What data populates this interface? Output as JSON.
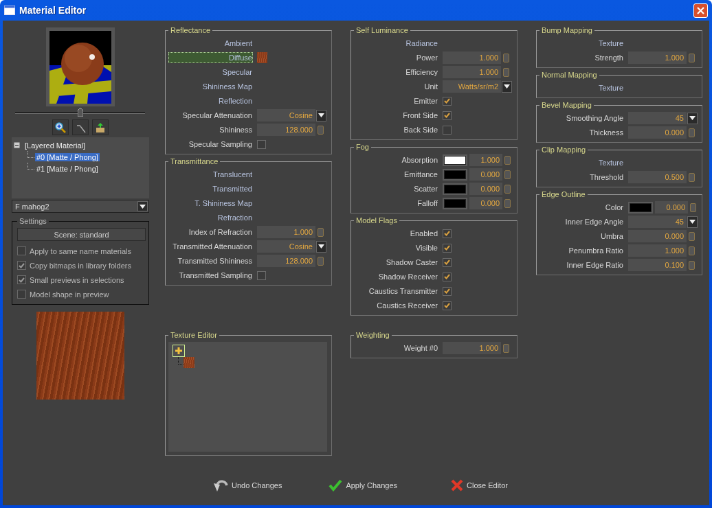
{
  "window": {
    "title": "Material Editor"
  },
  "preview": {
    "zoom_slider": {
      "level": 0.5
    }
  },
  "tree": [
    {
      "label": "[Layered Material]",
      "expanded": true,
      "children": [
        {
          "label": "#0 [Matte / Phong]",
          "selected": true
        },
        {
          "label": "#1 [Matte / Phong]",
          "selected": false
        }
      ]
    }
  ],
  "material_dropdown": {
    "value": "F mahog2"
  },
  "settings": {
    "title": "Settings",
    "scene_button": "Scene: standard",
    "options": [
      {
        "label": "Apply to same name materials",
        "checked": false
      },
      {
        "label": "Copy bitmaps in library folders",
        "checked": true
      },
      {
        "label": "Small previews in selections",
        "checked": true
      },
      {
        "label": "Model shape in preview",
        "checked": false
      }
    ]
  },
  "columns": [
    {
      "groups": [
        {
          "title": "Reflectance",
          "kind": "rows",
          "rows": [
            {
              "kind": "map",
              "label": "Ambient",
              "selected": false,
              "has_texture": false
            },
            {
              "kind": "map",
              "label": "Diffuse",
              "selected": true,
              "has_texture": true
            },
            {
              "kind": "map",
              "label": "Specular",
              "selected": false,
              "has_texture": false
            },
            {
              "kind": "map",
              "label": "Shininess Map",
              "selected": false,
              "has_texture": false
            },
            {
              "kind": "map",
              "label": "Reflection",
              "selected": false,
              "has_texture": false
            },
            {
              "kind": "dropdown",
              "label": "Specular Attenuation",
              "value": "Cosine"
            },
            {
              "kind": "number",
              "label": "Shininess",
              "value": "128.000"
            },
            {
              "kind": "checkbox",
              "label": "Specular Sampling",
              "checked": false
            }
          ]
        },
        {
          "title": "Transmittance",
          "kind": "rows",
          "rows": [
            {
              "kind": "map",
              "label": "Translucent",
              "selected": false,
              "has_texture": false
            },
            {
              "kind": "map",
              "label": "Transmitted",
              "selected": false,
              "has_texture": false
            },
            {
              "kind": "map",
              "label": "T. Shininess Map",
              "selected": false,
              "has_texture": false
            },
            {
              "kind": "map",
              "label": "Refraction",
              "selected": false,
              "has_texture": false
            },
            {
              "kind": "number",
              "label": "Index of Refraction",
              "value": "1.000"
            },
            {
              "kind": "dropdown",
              "label": "Transmitted Attenuation",
              "value": "Cosine"
            },
            {
              "kind": "number",
              "label": "Transmitted Shininess",
              "value": "128.000"
            },
            {
              "kind": "checkbox",
              "label": "Transmitted Sampling",
              "checked": false
            }
          ]
        }
      ],
      "lower_groups": [
        {
          "title": "Texture Editor",
          "kind": "texture_editor"
        }
      ]
    },
    {
      "groups": [
        {
          "title": "Self Luminance",
          "kind": "rows",
          "rows": [
            {
              "kind": "map",
              "label": "Radiance",
              "selected": false,
              "has_texture": false
            },
            {
              "kind": "number",
              "label": "Power",
              "value": "1.000"
            },
            {
              "kind": "number",
              "label": "Efficiency",
              "value": "1.000"
            },
            {
              "kind": "dropdown",
              "label": "Unit",
              "value": "Watts/sr/m2"
            },
            {
              "kind": "checkbox",
              "label": "Emitter",
              "checked": true
            },
            {
              "kind": "checkbox",
              "label": "Front Side",
              "checked": true
            },
            {
              "kind": "checkbox",
              "label": "Back Side",
              "checked": false
            }
          ]
        },
        {
          "title": "Fog",
          "kind": "rows",
          "rows": [
            {
              "kind": "color",
              "label": "Absorption",
              "color": "#ffffff",
              "value": "1.000"
            },
            {
              "kind": "color",
              "label": "Emittance",
              "color": "#000000",
              "value": "0.000"
            },
            {
              "kind": "color",
              "label": "Scatter",
              "color": "#000000",
              "value": "0.000"
            },
            {
              "kind": "color",
              "label": "Falloff",
              "color": "#000000",
              "value": "0.000"
            }
          ]
        },
        {
          "title": "Model Flags",
          "kind": "rows",
          "rows": [
            {
              "kind": "checkbox",
              "label": "Enabled",
              "checked": true
            },
            {
              "kind": "checkbox",
              "label": "Visible",
              "checked": true
            },
            {
              "kind": "checkbox",
              "label": "Shadow Caster",
              "checked": true
            },
            {
              "kind": "checkbox",
              "label": "Shadow Receiver",
              "checked": true
            },
            {
              "kind": "checkbox",
              "label": "Caustics Transmitter",
              "checked": true
            },
            {
              "kind": "checkbox",
              "label": "Caustics Receiver",
              "checked": true
            }
          ]
        }
      ],
      "lower_groups": [
        {
          "title": "Weighting",
          "kind": "rows",
          "rows": [
            {
              "kind": "number",
              "label": "Weight #0",
              "value": "1.000"
            }
          ]
        }
      ]
    },
    {
      "groups": [
        {
          "title": "Bump Mapping",
          "kind": "rows",
          "rows": [
            {
              "kind": "map",
              "label": "Texture",
              "selected": false,
              "has_texture": false
            },
            {
              "kind": "number",
              "label": "Strength",
              "value": "1.000"
            }
          ]
        },
        {
          "title": "Normal Mapping",
          "kind": "rows",
          "rows": [
            {
              "kind": "map",
              "label": "Texture",
              "selected": false,
              "has_texture": false
            }
          ]
        },
        {
          "title": "Bevel Mapping",
          "kind": "rows",
          "rows": [
            {
              "kind": "dropdown",
              "label": "Smoothing Angle",
              "value": "45"
            },
            {
              "kind": "number",
              "label": "Thickness",
              "value": "0.000"
            }
          ]
        },
        {
          "title": "Clip Mapping",
          "kind": "rows",
          "rows": [
            {
              "kind": "map",
              "label": "Texture",
              "selected": false,
              "has_texture": false
            },
            {
              "kind": "number",
              "label": "Threshold",
              "value": "0.500"
            }
          ]
        },
        {
          "title": "Edge Outline",
          "kind": "rows",
          "rows": [
            {
              "kind": "color",
              "label": "Color",
              "color": "#000000",
              "value": "0.000"
            },
            {
              "kind": "dropdown",
              "label": "Inner Edge Angle",
              "value": "45"
            },
            {
              "kind": "number",
              "label": "Umbra",
              "value": "0.000"
            },
            {
              "kind": "number",
              "label": "Penumbra Ratio",
              "value": "1.000"
            },
            {
              "kind": "number",
              "label": "Inner Edge Ratio",
              "value": "0.100"
            }
          ]
        }
      ]
    }
  ],
  "buttons": [
    {
      "kind": "undo",
      "label": "Undo Changes"
    },
    {
      "kind": "apply",
      "label": "Apply Changes"
    },
    {
      "kind": "close",
      "label": "Close Editor"
    }
  ]
}
